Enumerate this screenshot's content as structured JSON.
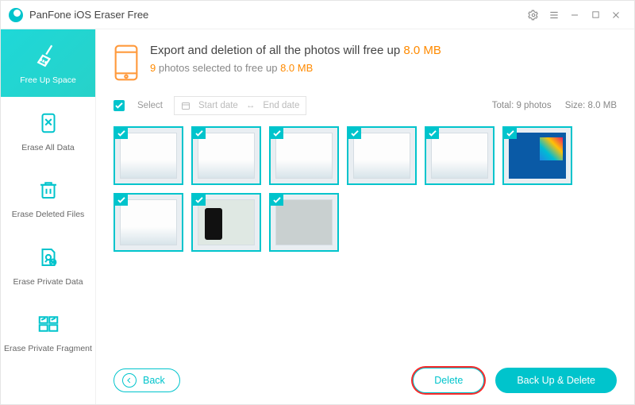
{
  "window": {
    "title": "PanFone iOS Eraser Free"
  },
  "sidebar": {
    "items": [
      {
        "label": "Free Up Space"
      },
      {
        "label": "Erase All Data"
      },
      {
        "label": "Erase Deleted Files"
      },
      {
        "label": "Erase Private Data"
      },
      {
        "label": "Erase Private Fragment"
      }
    ]
  },
  "header": {
    "line1_pre": "Export and deletion of all the photos will free up ",
    "line1_val": "8.0 MB",
    "line2_pre": "9",
    "line2_mid": " photos selected to free up ",
    "line2_val": "8.0 MB"
  },
  "filter": {
    "select_label": "Select",
    "start_ph": "Start date",
    "sep": "↔",
    "end_ph": "End date"
  },
  "summary": {
    "total": "Total: 9 photos",
    "size": "Size: 8.0 MB"
  },
  "photos": [
    {
      "type": "app"
    },
    {
      "type": "app"
    },
    {
      "type": "app"
    },
    {
      "type": "app"
    },
    {
      "type": "app"
    },
    {
      "type": "win"
    },
    {
      "type": "app"
    },
    {
      "type": "phone"
    },
    {
      "type": "blank"
    }
  ],
  "footer": {
    "back": "Back",
    "delete": "Delete",
    "backup": "Back Up & Delete"
  }
}
